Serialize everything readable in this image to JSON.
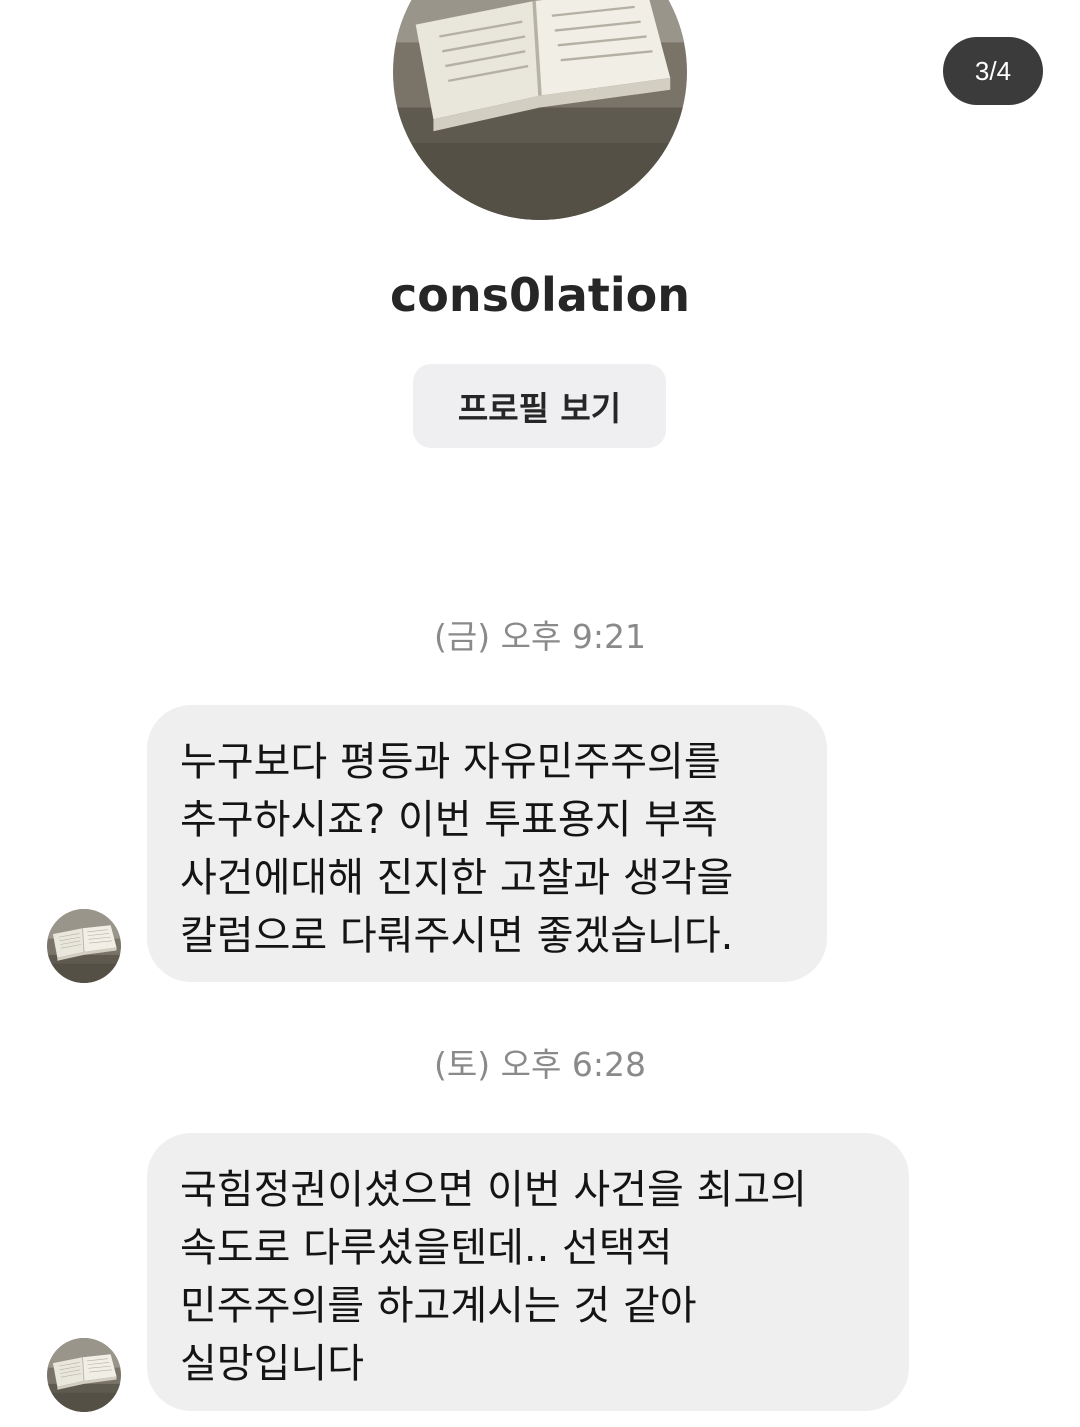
{
  "header": {
    "page_indicator": "3/4",
    "username": "cons0lation",
    "profile_button": "프로필 보기"
  },
  "conversation": [
    {
      "timestamp": "(금) 오후 9:21",
      "lines": [
        "누구보다 평등과 자유민주주의를",
        "추구하시죠? 이번 투표용지 부족",
        "사건에대해 진지한 고찰과 생각을",
        "칼럼으로 다뤄주시면 좋겠습니다."
      ]
    },
    {
      "timestamp": "(토) 오후 6:28",
      "lines": [
        "국힘정권이셨으면 이번 사건을 최고의",
        "속도로 다루셨을텐데..  선택적",
        "민주주의를 하고계시는 것 같아",
        "실망입니다"
      ]
    }
  ],
  "icons": {
    "avatar": "open-book-avatar-icon"
  },
  "colors": {
    "bubble": "#efefef",
    "badge": "#3b3b3b",
    "button": "#efeff1",
    "timestamp": "#8a8a8a"
  }
}
